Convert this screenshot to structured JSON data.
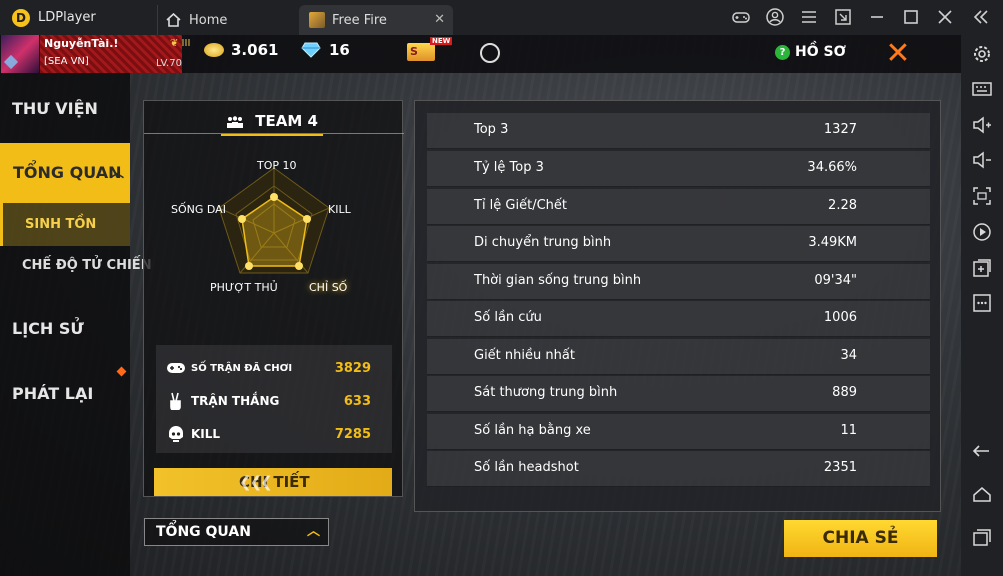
{
  "window": {
    "app_name": "LDPlayer",
    "tabs": [
      {
        "label": "Home",
        "icon": "home-icon"
      },
      {
        "label": "Free Fire",
        "icon": "free-fire-icon",
        "close": "✕"
      }
    ]
  },
  "player": {
    "name": "NguyễnTài.!",
    "clan": "[SEA   VN]",
    "level": "LV.70",
    "rank_marks": "❦ III"
  },
  "currency": {
    "gold": "3.061",
    "diamonds": "16",
    "new_badge": "NEW"
  },
  "header": {
    "profile_badge": "?",
    "profile_label": "HỒ SƠ"
  },
  "nav": {
    "library": "THƯ VIỆN",
    "overview": "TỔNG QUAN",
    "survival": "SINH TỒN",
    "deathmatch": "CHẾ ĐỘ TỬ CHIẾN",
    "history": "LỊCH SỬ",
    "replay": "PHÁT LẠI"
  },
  "team": {
    "title": "TEAM 4",
    "radar_labels": {
      "top10": "TOP 10",
      "kill": "KILL",
      "survive": "SỐNG DAI",
      "rush": "PHƯỢT THỦ",
      "index": "CHỈ SỐ"
    }
  },
  "summary": {
    "matches_label": "SỐ TRẬN ĐÃ CHƠI",
    "matches_value": "3829",
    "wins_label": "TRẬN THẮNG",
    "wins_value": "633",
    "kills_label": "KILL",
    "kills_value": "7285"
  },
  "buttons": {
    "detail": "CHI TIẾT",
    "share": "CHIA SẺ",
    "overview_dropdown": "TỔNG QUAN"
  },
  "stats": [
    {
      "label": "Top 3",
      "value": "1327"
    },
    {
      "label": "Tỷ lệ Top 3",
      "value": "34.66%"
    },
    {
      "label": "Tỉ lệ Giết/Chết",
      "value": "2.28"
    },
    {
      "label": "Di chuyển trung bình",
      "value": "3.49KM"
    },
    {
      "label": "Thời gian sống trung bình",
      "value": "09'34\""
    },
    {
      "label": "Số lần cứu",
      "value": "1006"
    },
    {
      "label": "Giết nhiều nhất",
      "value": "34"
    },
    {
      "label": "Sát thương trung bình",
      "value": "889"
    },
    {
      "label": "Số lần hạ bằng xe",
      "value": "11"
    },
    {
      "label": "Số lần headshot",
      "value": "2351"
    }
  ]
}
